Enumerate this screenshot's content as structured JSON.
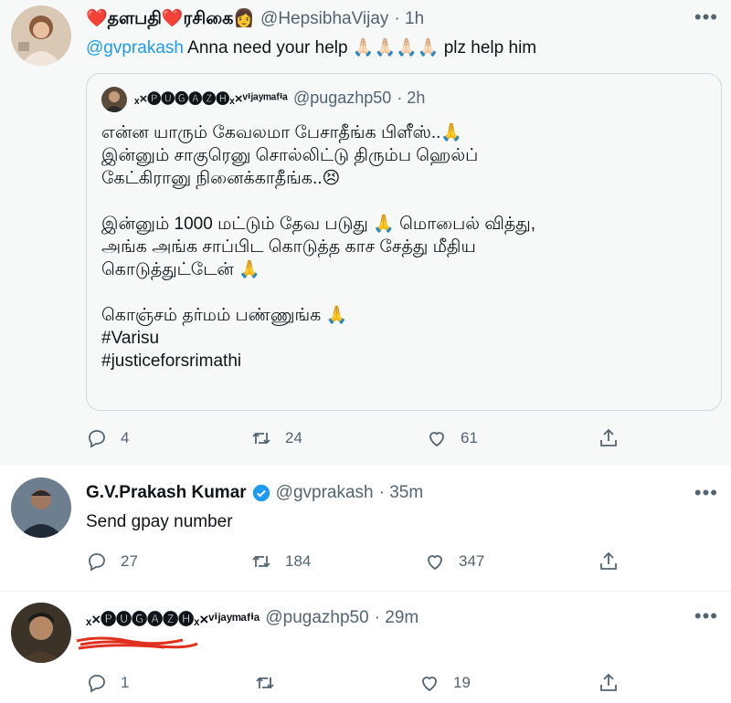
{
  "tweets": [
    {
      "name": "❤️தளபதி❤️ரசிகை👩",
      "handle": "@HepsibhaVijay",
      "time": "· 1h",
      "more": "•••",
      "mention": "@gvprakash",
      "text": " Anna need your help 🙏🏻🙏🏻🙏🏻🙏🏻 plz help him",
      "replies": "4",
      "retweets": "24",
      "likes": "61",
      "quote": {
        "name": "ₓ×🅟🅤🅖🅐🅩🅗ₓ×ᵛⁱʲᵃʸᵐᵃᶠⁱᵃ",
        "handle": "@pugazhp50",
        "time": "· 2h",
        "lines": [
          "என்ன யாரும் கேவலமா பேசாதீங்க பிளீஸ்..🙏",
          "இன்னும் சாகுரெனு சொல்லிட்டு திரும்ப ஹெல்ப்",
          "கேட்கிரானு நினைக்காதீங்க..😣",
          "",
          "இன்னும் 1000 மட்டும் தேவ படுது 🙏 மொபைல் வித்து,",
          "அங்க அங்க சாப்பிட கொடுத்த காச சேத்து மீதிய",
          "கொடுத்துட்டேன் 🙏",
          "",
          "கொஞ்சம் தர்மம் பண்ணுங்க 🙏",
          "#Varisu",
          "#justiceforsrimathi"
        ]
      }
    },
    {
      "name": "G.V.Prakash Kumar",
      "handle": "@gvprakash",
      "time": "· 35m",
      "more": "•••",
      "text": "Send gpay number",
      "replies": "27",
      "retweets": "184",
      "likes": "347"
    },
    {
      "name": "ₓ×🅟🅤🅖🅐🅩🅗ₓ×ᵛⁱʲᵃʸᵐᵃᶠⁱᵃ",
      "handle": "@pugazhp50",
      "time": "· 29m",
      "more": "•••",
      "replies": "1",
      "retweets": "",
      "likes": "19"
    }
  ],
  "colors": {
    "link": "#1d9bf0",
    "muted": "#536471",
    "verified": "#1d9bf0",
    "scribble": "#e0301e"
  }
}
